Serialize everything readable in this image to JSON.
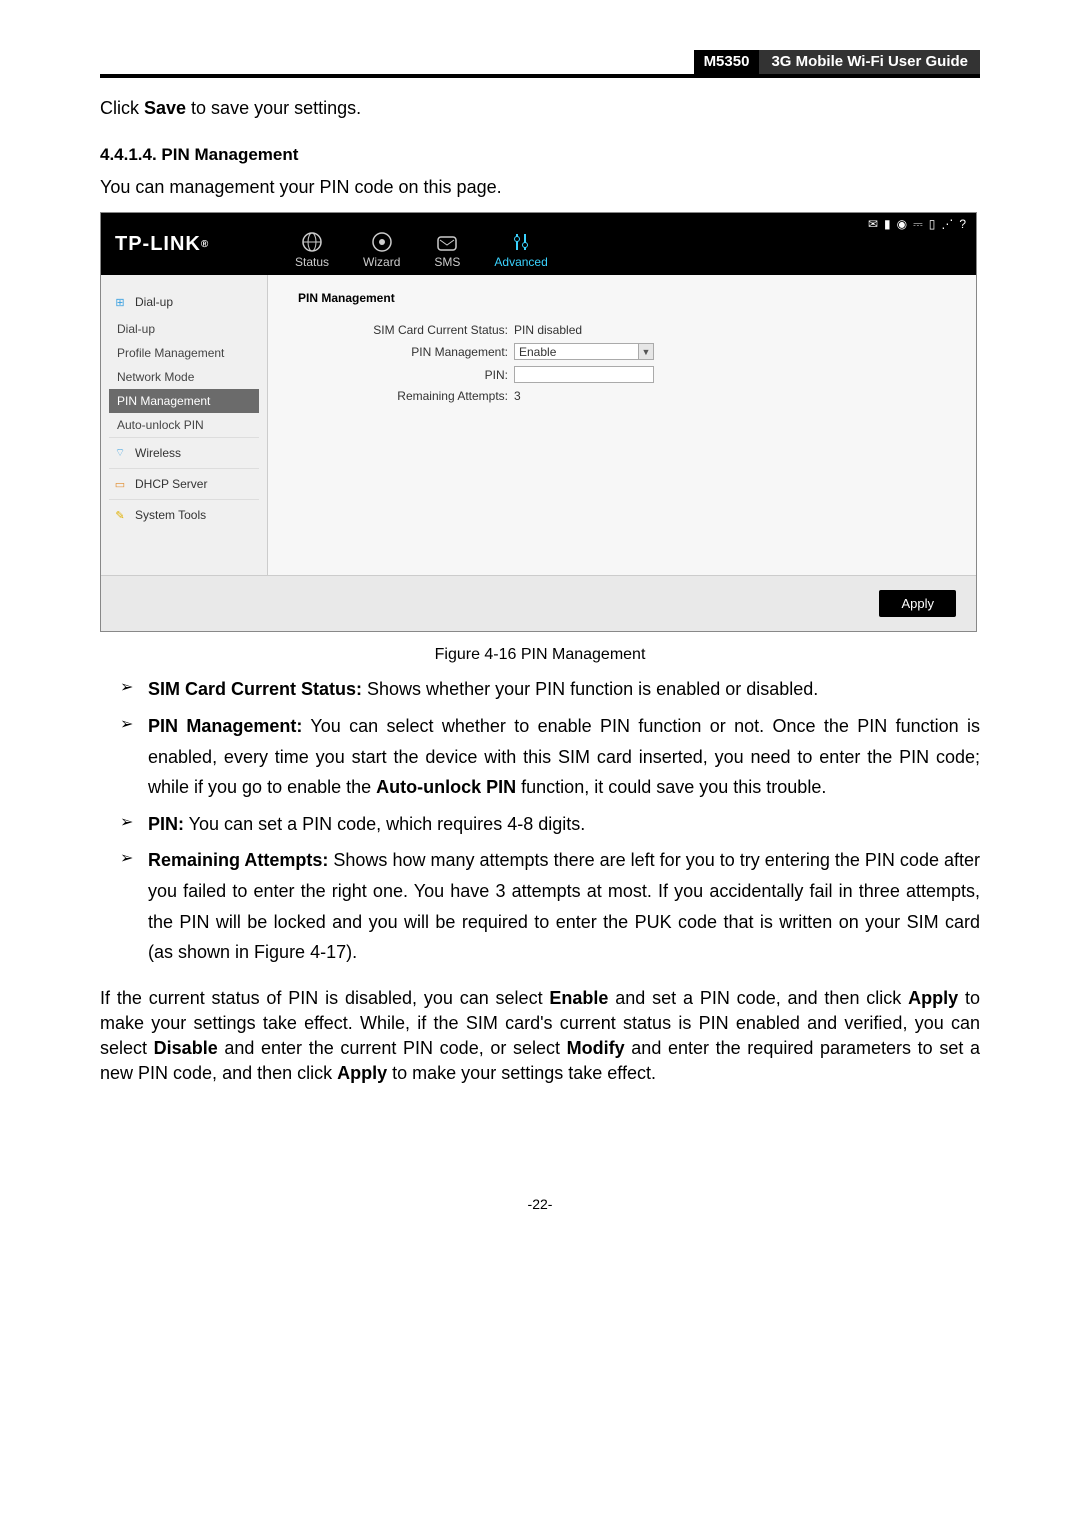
{
  "header": {
    "model": "M5350",
    "title": "3G Mobile Wi-Fi User Guide"
  },
  "intro1_a": "Click ",
  "intro1_b": "Save",
  "intro1_c": " to save your settings.",
  "section_no": "4.4.1.4.  PIN Management",
  "intro2": "You can management your PIN code on this page.",
  "app": {
    "brand": "TP-LINK",
    "tabs": {
      "status": "Status",
      "wizard": "Wizard",
      "sms": "SMS",
      "advanced": "Advanced"
    },
    "sidebar": {
      "dialup": "Dial-up",
      "sub_dialup": "Dial-up",
      "sub_profile": "Profile Management",
      "sub_network": "Network Mode",
      "sub_pin": "PIN Management",
      "sub_auto": "Auto-unlock PIN",
      "wireless": "Wireless",
      "dhcp": "DHCP Server",
      "tools": "System Tools"
    },
    "content": {
      "title": "PIN Management",
      "row1_label": "SIM Card Current Status:",
      "row1_val": "PIN disabled",
      "row2_label": "PIN Management:",
      "row2_val": "Enable",
      "row3_label": "PIN:",
      "row4_label": "Remaining Attempts:",
      "row4_val": "3"
    },
    "apply": "Apply"
  },
  "caption": "Figure 4-16 PIN Management",
  "bullets": {
    "b1_a": "SIM Card Current Status:",
    "b1_b": " Shows whether your PIN function is enabled or disabled.",
    "b2_a": "PIN Management:",
    "b2_b": " You can select whether to enable PIN function or not. Once the PIN function is enabled, every time you start the device with this SIM card inserted, you need to enter the PIN code; while if you go to enable the ",
    "b2_c": "Auto-unlock PIN",
    "b2_d": " function, it could save you this trouble.",
    "b3_a": "PIN:",
    "b3_b": " You can set a PIN code, which requires 4-8 digits.",
    "b4_a": "Remaining Attempts:",
    "b4_b": " Shows how many attempts there are left for you to try entering the PIN code after you failed to enter the right one. You have 3 attempts at most. If you accidentally fail in three attempts, the PIN will be locked and you will be required to enter the PUK code that is written on your SIM card (as shown in Figure 4-17)."
  },
  "para2_a": "If the current status of PIN is disabled, you can select ",
  "para2_b": "Enable",
  "para2_c": " and set a PIN code, and then click ",
  "para2_d": "Apply",
  "para2_e": " to make your settings take effect. While, if the SIM card's current status is PIN enabled and verified, you can select ",
  "para2_f": "Disable",
  "para2_g": " and enter the current PIN code, or select ",
  "para2_h": "Modify",
  "para2_i": " and enter the required parameters to set a new PIN code, and then click ",
  "para2_j": "Apply",
  "para2_k": " to make your settings take effect.",
  "page_num": "-22-"
}
